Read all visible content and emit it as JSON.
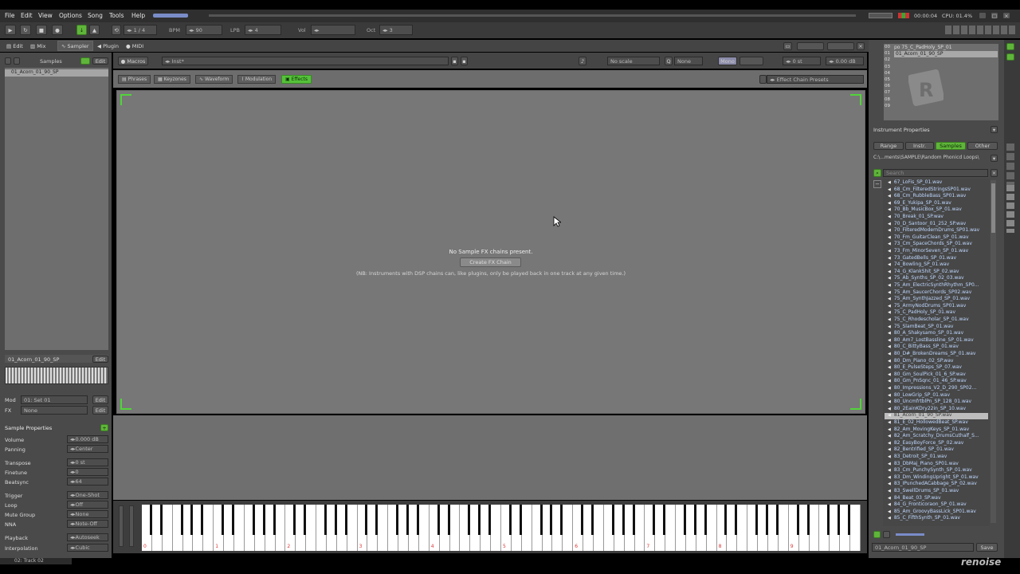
{
  "menu": [
    "File",
    "Edit",
    "View",
    "Options",
    "Song",
    "Tools",
    "Help"
  ],
  "status": {
    "time": "00:00:04",
    "cpu": "CPU: 01.4%"
  },
  "transport": {
    "pattern_step": "1 / 4",
    "bpm_label": "BPM",
    "bpm_value": "90",
    "lpb_label": "LPB",
    "lpb_value": "4",
    "vol_label": "Vol",
    "oct_label": "Oct",
    "oct_value": "3"
  },
  "left_tabs": {
    "edit": "Edit",
    "mix": "Mix",
    "sampler": "Sampler",
    "plugin": "Plugin",
    "midi": "MIDI"
  },
  "samples_header": "Samples",
  "edit_label": "Edit",
  "sample_selected": "01_Acorn_01_90_SP",
  "sample_slot_name": "01_Acorn_01_90_SP",
  "mod_row": {
    "label": "Mod",
    "value": "01: Set 01"
  },
  "fx_row": {
    "label": "FX",
    "value": "None"
  },
  "sample_props": {
    "title": "Sample Properties",
    "rows": [
      {
        "label": "Volume",
        "value": "0.000 dB"
      },
      {
        "label": "Panning",
        "value": "Center"
      },
      {
        "label": "Transpose",
        "value": "0 st"
      },
      {
        "label": "Finetune",
        "value": "0"
      },
      {
        "label": "Beatsync",
        "value": "64"
      },
      {
        "label": "Trigger",
        "value": "One-Shot"
      },
      {
        "label": "Loop",
        "value": "Off"
      },
      {
        "label": "Mute Group",
        "value": "None"
      },
      {
        "label": "NNA",
        "value": "Note-Off"
      },
      {
        "label": "Playback",
        "value": "Autoseek"
      },
      {
        "label": "Interpolation",
        "value": "Cubic"
      }
    ]
  },
  "macros_bar": {
    "macros": "Macros",
    "inst": "Inst*",
    "scale": "No scale",
    "key": "None",
    "mono": "Mono",
    "tr": "0 st",
    "vol": "0.00 dB"
  },
  "lower_tabs": [
    "Phrases",
    "Keyzones",
    "Waveform",
    "Modulation",
    "Effects"
  ],
  "active_lower_tab": "Effects",
  "preset_field": "Effect Chain Presets",
  "fx_empty": {
    "message": "No Sample FX chains present.",
    "button": "Create FX Chain",
    "note": "(NB: Instruments with DSP chains can, like plugins, only be played back in one track at any given time.)"
  },
  "instrument_list": {
    "rows": [
      "00",
      "01",
      "02",
      "03",
      "04",
      "05",
      "06",
      "07",
      "08",
      "09"
    ],
    "first": "po 75_C_PadHoly_SP_01",
    "second": "01_Acorn_01_90_SP"
  },
  "instrument_props": {
    "title": "Instrument Properties",
    "tabs": [
      "Range",
      "Instr.",
      "Samples",
      "Other"
    ],
    "path": "C:\\...ments\\SAMPLE\\Random Phonicd Loops\\"
  },
  "search_placeholder": "Search",
  "files": [
    "67_LoFis_SP_01.wav",
    "68_Cm_FilteredStringsSP01.wav",
    "68_Cm_RubbleBass_SP01.wav",
    "69_E_Yukipa_SP_01.wav",
    "70_Bb_MusicBox_SP_01.wav",
    "70_Break_01_SP.wav",
    "70_D_Santoor_01_252_SP.wav",
    "70_FilteredModernDrums_SP01.wav",
    "70_Fm_GuitarClean_SP_01.wav",
    "73_Cm_SpaceChords_SP_01.wav",
    "73_Fm_MinorSeven_SP_01.wav",
    "73_GatedBells_SP_01.wav",
    "74_Bowling_SP_01.wav",
    "74_G_KlankShit_SP_02.wav",
    "75_Ab_Synths_SP_02_03.wav",
    "75_Am_ElectricSynthRhythm_SP0...",
    "75_Am_SaucerChords_SP02.wav",
    "75_Am_SynthJazzed_SP_01.wav",
    "75_ArmyNodDrums_SP01.wav",
    "75_C_PadHoly_SP_01.wav",
    "75_C_Rhodescholar_SP_01.wav",
    "75_SlamBeat_SP_01.wav",
    "80_A_Shakysamo_SP_01.wav",
    "80_Am7_LostBassline_SP_01.wav",
    "80_C_BittyBass_SP_01.wav",
    "80_D#_BrokenDreams_SP_01.wav",
    "80_Dm_Piano_02_SP.wav",
    "80_E_PulseSteps_SP_07.wav",
    "80_Gm_SoulPick_01_6_SP.wav",
    "80_Gm_PnSqnc_01_46_SP.wav",
    "80_Impressions_V2_D_290_SP02...",
    "80_LowGrip_SP_01.wav",
    "80_UncmfrtblPn_SP_128_01.wav",
    "80_2EainKDry22in_SP_10.wav",
    "81_Acorn_01_90_SP.wav",
    "81_E_02_HollowedBeat_SP.wav",
    "82_Am_MovingKeys_SP_01.wav",
    "82_Am_Scratchy_DrumsCuthalf_S...",
    "82_EasyBoyForce_SP_02.wav",
    "82_Bentrified_SP_01.wav",
    "83_Detroit_SP_01.wav",
    "83_DbMaj_Piano_SP01.wav",
    "83_Cm_PunchySynth_SP_01.wav",
    "83_Dm_WindingUpright_SP_01.wav",
    "83_IPunchedACabbage_SP_02.wav",
    "83_SwellDrums_SP_01.wav",
    "84_Beat_03_SP.wav",
    "84_G_Fronticoraon_SP_01.wav",
    "85_Am_GroovyBassLick_SP01.wav",
    "85_C_FifthSynth_SP_01.wav"
  ],
  "selected_file": "81_Acorn_01_90_SP.wav",
  "bottom_name": "01_Acorn_01_90_SP",
  "bottom_save": "Save",
  "octave_labels": [
    "0",
    "1",
    "2",
    "3",
    "4",
    "5",
    "6",
    "7",
    "8",
    "9"
  ],
  "footer": {
    "track": "02: Track 02",
    "brand": "renoise"
  }
}
